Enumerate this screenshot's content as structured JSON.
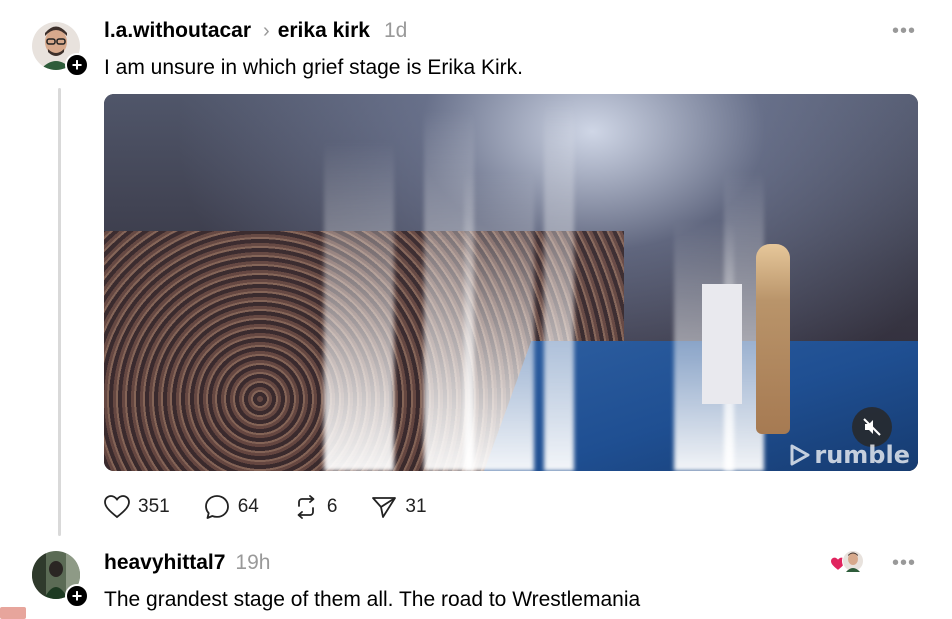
{
  "post1": {
    "username": "l.a.withoutacar",
    "reply_to": "erika kirk",
    "time": "1d",
    "text": "I am unsure in which grief stage is Erika Kirk.",
    "media": {
      "watermark": "rumble"
    },
    "actions": {
      "likes": "351",
      "comments": "64",
      "reposts": "6",
      "shares": "31"
    }
  },
  "post2": {
    "username": "heavyhittal7",
    "time": "19h",
    "text": "The grandest stage of them all. The road to Wrestlemania"
  },
  "icons": {
    "more": "ellipsis-icon",
    "follow": "plus-icon",
    "like": "heart-icon",
    "comment": "comment-icon",
    "repost": "repost-icon",
    "share": "share-icon",
    "mute": "volume-muted-icon"
  },
  "colors": {
    "muted_text": "#999999",
    "thread_line": "#d9d9d9",
    "liked_heart": "#e0245e"
  }
}
